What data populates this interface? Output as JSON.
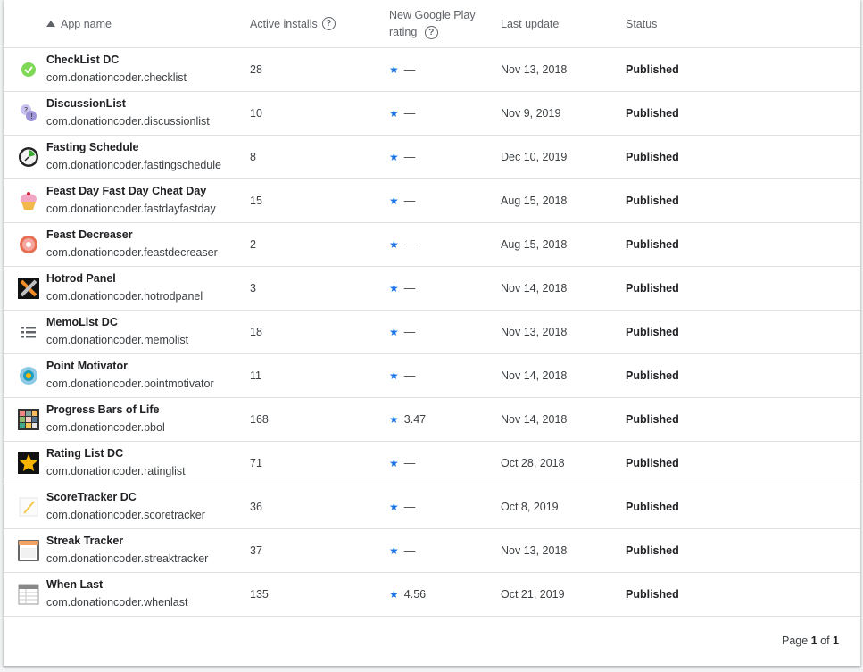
{
  "header": {
    "app_name": "App name",
    "active_installs": "Active installs",
    "rating_line1": "New Google Play",
    "rating_line2": "rating",
    "last_update": "Last update",
    "status": "Status",
    "help_glyph": "?"
  },
  "rows": [
    {
      "name": "CheckList DC",
      "pkg": "com.donationcoder.checklist",
      "installs": "28",
      "rating": "—",
      "update": "Nov 13, 2018",
      "status": "Published",
      "icon": "checklist-icon"
    },
    {
      "name": "DiscussionList",
      "pkg": "com.donationcoder.discussionlist",
      "installs": "10",
      "rating": "—",
      "update": "Nov 9, 2019",
      "status": "Published",
      "icon": "discussion-icon"
    },
    {
      "name": "Fasting Schedule",
      "pkg": "com.donationcoder.fastingschedule",
      "installs": "8",
      "rating": "—",
      "update": "Dec 10, 2019",
      "status": "Published",
      "icon": "clock-icon"
    },
    {
      "name": "Feast Day Fast Day Cheat Day",
      "pkg": "com.donationcoder.fastdayfastday",
      "installs": "15",
      "rating": "—",
      "update": "Aug 15, 2018",
      "status": "Published",
      "icon": "cupcake-icon"
    },
    {
      "name": "Feast Decreaser",
      "pkg": "com.donationcoder.feastdecreaser",
      "installs": "2",
      "rating": "—",
      "update": "Aug 15, 2018",
      "status": "Published",
      "icon": "donut-icon"
    },
    {
      "name": "Hotrod Panel",
      "pkg": "com.donationcoder.hotrodpanel",
      "installs": "3",
      "rating": "—",
      "update": "Nov 14, 2018",
      "status": "Published",
      "icon": "tools-icon"
    },
    {
      "name": "MemoList DC",
      "pkg": "com.donationcoder.memolist",
      "installs": "18",
      "rating": "—",
      "update": "Nov 13, 2018",
      "status": "Published",
      "icon": "list-icon"
    },
    {
      "name": "Point Motivator",
      "pkg": "com.donationcoder.pointmotivator",
      "installs": "11",
      "rating": "—",
      "update": "Nov 14, 2018",
      "status": "Published",
      "icon": "target-icon"
    },
    {
      "name": "Progress Bars of Life",
      "pkg": "com.donationcoder.pbol",
      "installs": "168",
      "rating": "3.47",
      "update": "Nov 14, 2018",
      "status": "Published",
      "icon": "grid-icon"
    },
    {
      "name": "Rating List DC",
      "pkg": "com.donationcoder.ratinglist",
      "installs": "71",
      "rating": "—",
      "update": "Oct 28, 2018",
      "status": "Published",
      "icon": "star-icon"
    },
    {
      "name": "ScoreTracker DC",
      "pkg": "com.donationcoder.scoretracker",
      "installs": "36",
      "rating": "—",
      "update": "Oct 8, 2019",
      "status": "Published",
      "icon": "pencil-icon"
    },
    {
      "name": "Streak Tracker",
      "pkg": "com.donationcoder.streaktracker",
      "installs": "37",
      "rating": "—",
      "update": "Nov 13, 2018",
      "status": "Published",
      "icon": "calendar-icon"
    },
    {
      "name": "When Last",
      "pkg": "com.donationcoder.whenlast",
      "installs": "135",
      "rating": "4.56",
      "update": "Oct 21, 2019",
      "status": "Published",
      "icon": "table-icon"
    }
  ],
  "star_glyph": "★",
  "footer": {
    "page_label": "Page",
    "current_page": "1",
    "of_label": "of",
    "total_pages": "1"
  },
  "colors": {
    "accent": "#1a73e8",
    "border": "#e0e0e0",
    "text_secondary": "#5f6368"
  }
}
